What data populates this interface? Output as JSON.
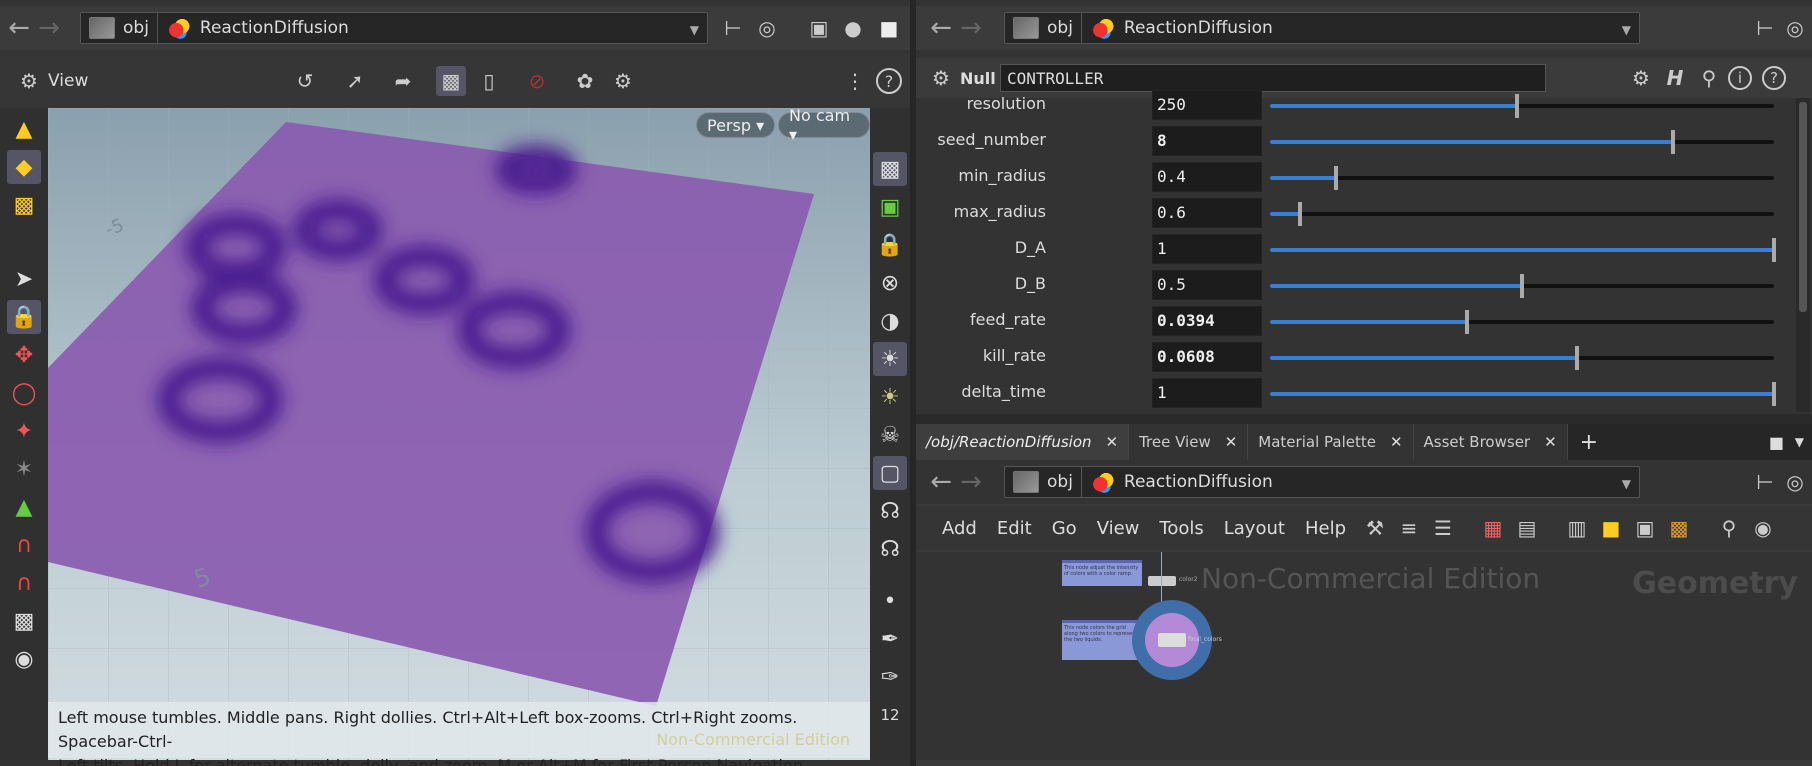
{
  "left_pane": {
    "path": {
      "obj": "obj",
      "node": "ReactionDiffusion"
    },
    "view_title": "View",
    "camera": {
      "persp": "Persp ▾",
      "cam": "No cam ▾"
    },
    "help_line1": "Left mouse tumbles. Middle pans. Right dollies. Ctrl+Alt+Left box-zooms. Ctrl+Right zooms. Spacebar-Ctrl-",
    "help_line2": "Left tilts. Hold L for alternate tumble, dolly, and zoom.     M or Alt+M for First Person Navigation.",
    "watermark": "Non-Commercial Edition",
    "grid_label_a": "-5",
    "grid_label_b": "5",
    "right_tool_number": "12"
  },
  "param_pane": {
    "path": {
      "obj": "obj",
      "node": "ReactionDiffusion"
    },
    "node_type": "Null",
    "node_name": "CONTROLLER",
    "params": [
      {
        "label": "resolution",
        "value": "250",
        "fraction": 0.49,
        "bold": false
      },
      {
        "label": "seed_number",
        "value": "8",
        "fraction": 0.8,
        "bold": true
      },
      {
        "label": "min_radius",
        "value": "0.4",
        "fraction": 0.13,
        "bold": false
      },
      {
        "label": "max_radius",
        "value": "0.6",
        "fraction": 0.06,
        "bold": false
      },
      {
        "label": "D_A",
        "value": "1",
        "fraction": 1.0,
        "bold": false
      },
      {
        "label": "D_B",
        "value": "0.5",
        "fraction": 0.5,
        "bold": false
      },
      {
        "label": "feed_rate",
        "value": "0.0394",
        "fraction": 0.39,
        "bold": true
      },
      {
        "label": "kill_rate",
        "value": "0.0608",
        "fraction": 0.61,
        "bold": true
      },
      {
        "label": "delta_time",
        "value": "1",
        "fraction": 1.0,
        "bold": false
      }
    ]
  },
  "network_pane": {
    "tabs": [
      {
        "label": "/obj/ReactionDiffusion"
      },
      {
        "label": "Tree View"
      },
      {
        "label": "Material Palette"
      },
      {
        "label": "Asset Browser"
      }
    ],
    "add_tab": "+",
    "path": {
      "obj": "obj",
      "node": "ReactionDiffusion"
    },
    "menus": [
      "Add",
      "Edit",
      "Go",
      "View",
      "Tools",
      "Layout",
      "Help"
    ],
    "watermark": "Non-Commercial Edition",
    "context_label": "Geometry",
    "sticky1": "This node adjust the intensity of colors with a color ramp.",
    "sticky2": "This node colors the grid along two colors to represent the two liquids.",
    "node1_label": "color2",
    "node2_label": "final_colors"
  },
  "colors": {
    "accent": "#3a7fd6",
    "plane": "#8a5bb0",
    "spot": "#4a1a90"
  }
}
